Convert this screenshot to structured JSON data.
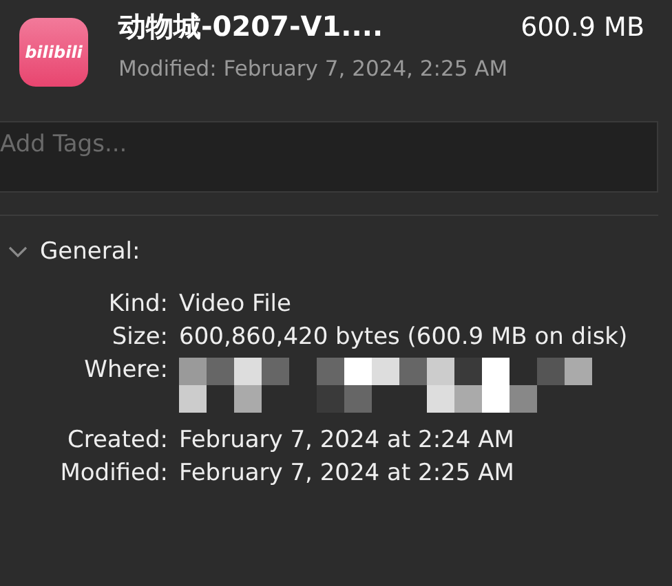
{
  "header": {
    "app_logo_text": "bilibili",
    "title": "动物城-0207-V1....",
    "size": "600.9 MB",
    "modified": "Modified: February 7, 2024, 2:25 AM"
  },
  "tags": {
    "placeholder": "Add Tags..."
  },
  "section": {
    "title": "General:",
    "expanded": true,
    "rows": [
      {
        "kind": "text",
        "label": "Kind:",
        "value": "Video File"
      },
      {
        "kind": "text",
        "label": "Size:",
        "value": "600,860,420 bytes (600.9 MB on disk)"
      },
      {
        "kind": "redacted",
        "label": "Where:"
      },
      {
        "kind": "text",
        "label": "Created:",
        "value": "February 7, 2024 at 2:24 AM"
      },
      {
        "kind": "text",
        "label": "Modified:",
        "value": "February 7, 2024 at 2:25 AM"
      }
    ]
  }
}
